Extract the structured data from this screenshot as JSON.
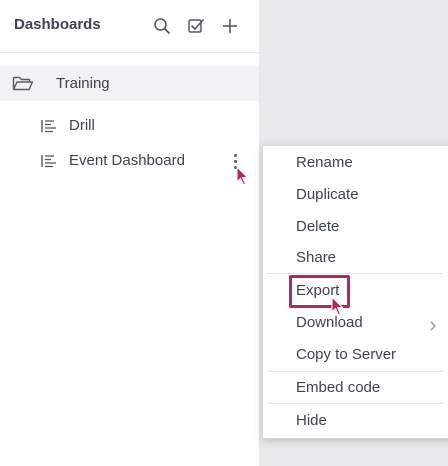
{
  "sidebar": {
    "title": "Dashboards",
    "icons": [
      "search-icon",
      "select-all-icon",
      "add-icon"
    ],
    "folder": {
      "label": "Training",
      "icon": "folder-open-icon"
    },
    "dashboards": [
      {
        "label": "Drill",
        "icon": "dashboard-list-icon"
      },
      {
        "label": "Event Dashboard",
        "icon": "dashboard-list-icon"
      }
    ]
  },
  "context_menu": {
    "items": {
      "rename": "Rename",
      "duplicate": "Duplicate",
      "delete": "Delete",
      "share": "Share",
      "export": "Export",
      "download": "Download",
      "copy_to_server": "Copy to Server",
      "embed_code": "Embed code",
      "hide": "Hide"
    }
  },
  "colors": {
    "highlight": "#b5265e",
    "cursor": "#b5265e",
    "sidebar_bg": "#ffffff",
    "canvas_bg": "#e9e9ec"
  }
}
